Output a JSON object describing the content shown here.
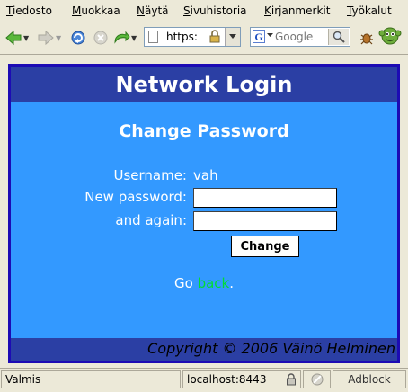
{
  "menubar": {
    "items": [
      {
        "accel": "T",
        "rest": "iedosto"
      },
      {
        "accel": "M",
        "rest": "uokkaa"
      },
      {
        "accel": "N",
        "rest": "äytä"
      },
      {
        "accel": "S",
        "rest": "ivuhistoria"
      },
      {
        "accel": "K",
        "rest": "irjanmerkit"
      },
      {
        "accel": "T",
        "rest": "yökalut"
      }
    ]
  },
  "toolbar": {
    "url_text": "https:",
    "search_placeholder": "Google",
    "search_engine_letter": "G"
  },
  "page": {
    "title": "Network Login",
    "subtitle": "Change Password",
    "username_label": "Username:",
    "username_value": "vah",
    "new_password_label": "New password:",
    "again_label": "and again:",
    "change_button": "Change",
    "go_text": "Go",
    "back_link": "back",
    "back_suffix": ".",
    "copyright": "Copyright © 2006 Väinö Helminen"
  },
  "colors": {
    "panel_background": "#3399ff",
    "header_band": "#2b3fa4",
    "panel_border": "#1c0bb4",
    "link": "#00dd33"
  },
  "statusbar": {
    "status": "Valmis",
    "host": "localhost:8443",
    "adblock": "Adblock"
  }
}
